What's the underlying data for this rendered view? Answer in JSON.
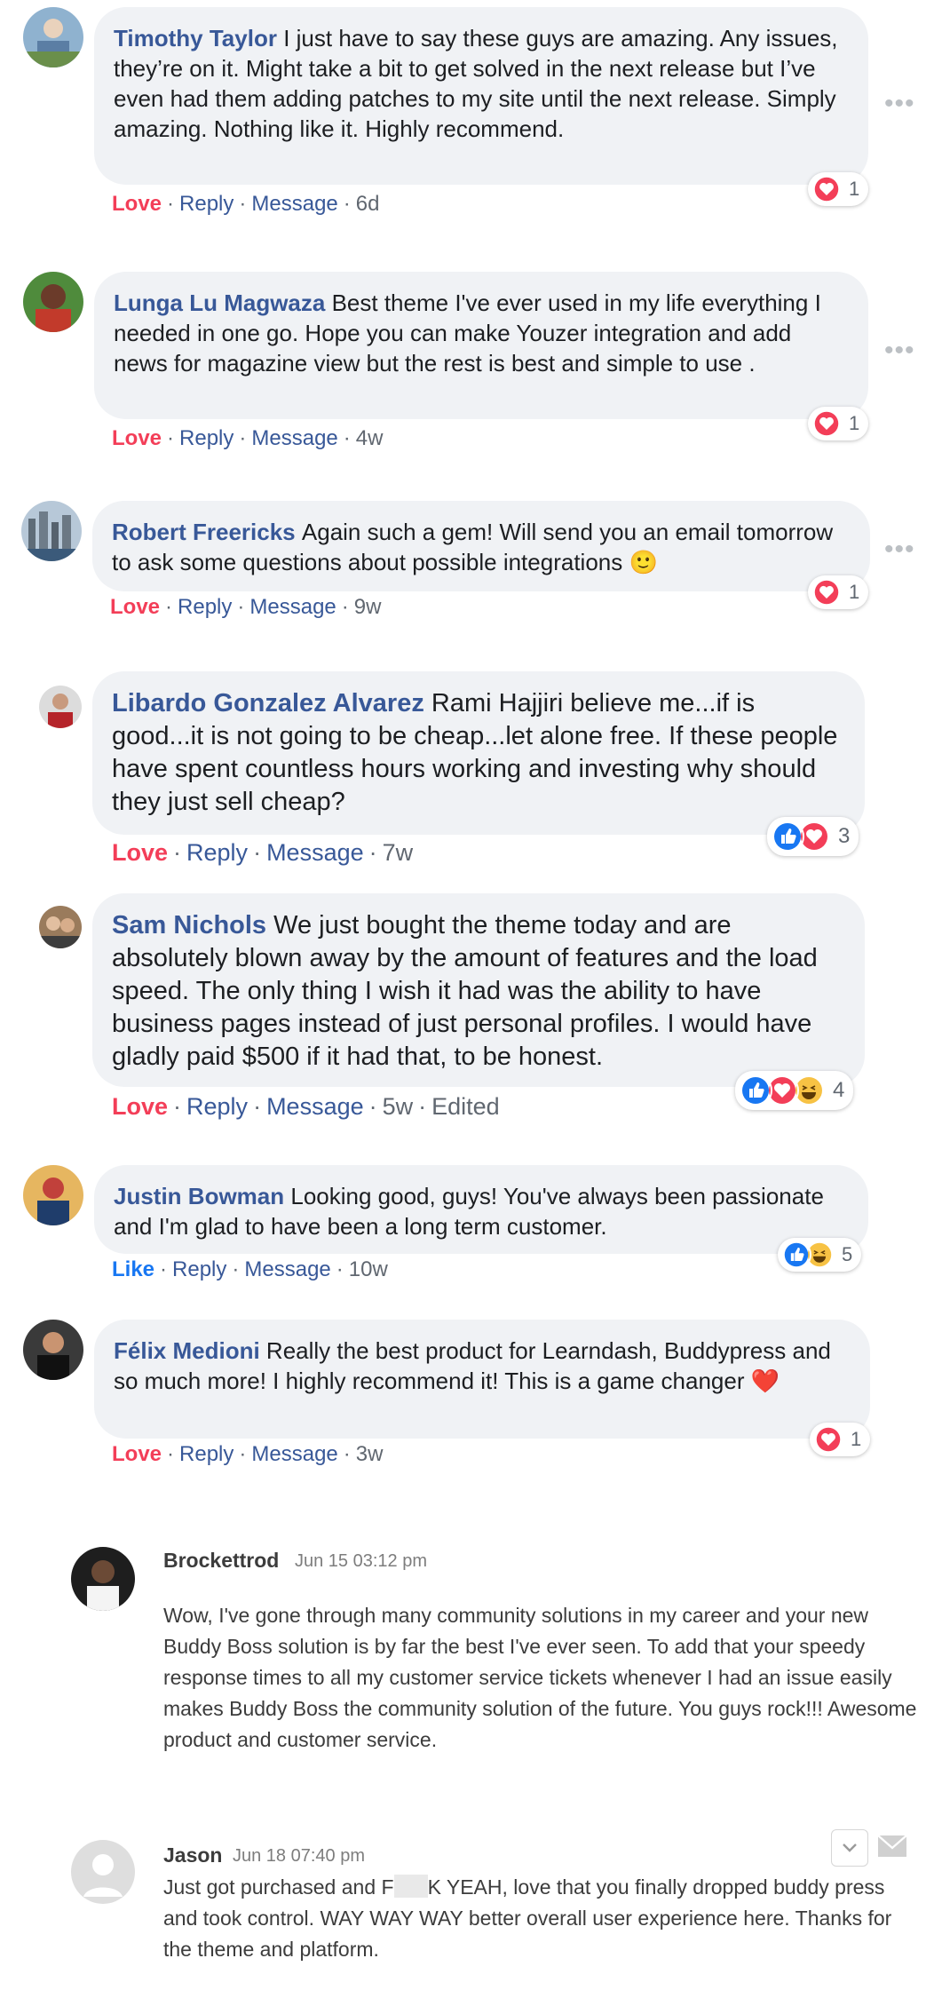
{
  "comments": [
    {
      "author": "Timothy Taylor",
      "text": "I just have to say these guys are amazing. Any issues, they’re on it. Might take a bit to get solved in the next release but I’ve even had them adding patches to my site until the next release. Simply amazing. Nothing like it. Highly recommend.",
      "reaction_label": "Love",
      "reply": "Reply",
      "message": "Message",
      "time": "6d",
      "reaction_count": "1"
    },
    {
      "author": "Lunga Lu Magwaza",
      "text": "Best theme I've ever used in my life everything I needed in one go. Hope you can make Youzer integration and add news for magazine view but the rest is best and simple to use .",
      "reaction_label": "Love",
      "reply": "Reply",
      "message": "Message",
      "time": "4w",
      "reaction_count": "1"
    },
    {
      "author": "Robert Freericks",
      "text": "Again such a gem! Will send you an email tomorrow to ask some questions about possible integrations",
      "emoji": "🙂",
      "reaction_label": "Love",
      "reply": "Reply",
      "message": "Message",
      "time": "9w",
      "reaction_count": "1"
    },
    {
      "author": "Libardo Gonzalez Alvarez",
      "text": "Rami Hajjiri believe me...if is good...it is not going to be cheap...let alone free. If these people have spent countless hours working and investing why should they just sell cheap?",
      "reaction_label": "Love",
      "reply": "Reply",
      "message": "Message",
      "time": "7w",
      "reaction_count": "3"
    },
    {
      "author": "Sam Nichols",
      "text": "We just bought the theme today and are absolutely blown away by the amount of features and the load speed. The only thing I wish it had was the ability to have business pages instead of just personal profiles. I would have gladly paid $500 if it had that, to be honest.",
      "reaction_label": "Love",
      "reply": "Reply",
      "message": "Message",
      "time": "5w",
      "edited": "Edited",
      "reaction_count": "4"
    },
    {
      "author": "Justin Bowman",
      "text": "Looking good, guys! You've always been passionate and I'm glad to have been a long term customer.",
      "reaction_label": "Like",
      "reply": "Reply",
      "message": "Message",
      "time": "10w",
      "reaction_count": "5"
    },
    {
      "author": "Félix Medioni",
      "text": "Really the best product for Learndash, Buddypress and so much more! I highly recommend it! This is a game changer",
      "emoji": "❤️",
      "reaction_label": "Love",
      "reply": "Reply",
      "message": "Message",
      "time": "3w",
      "reaction_count": "1"
    }
  ],
  "forum_posts": [
    {
      "author": "Brockettrod",
      "date": "Jun 15 03:12 pm",
      "text": "Wow, I've gone through many community solutions in my career and your new Buddy Boss solution is by far the best I've ever seen. To add that your speedy response times to all my customer service tickets whenever I had an issue easily makes Buddy Boss the community solution of the future. You guys rock!!! Awesome product and customer service."
    },
    {
      "author": "Jason",
      "date": "Jun 18 07:40 pm",
      "text_before": "Just got purchased and F",
      "text_after": "K YEAH, love that you finally dropped buddy press and took control. WAY WAY WAY better overall user experience here. Thanks for the theme and platform."
    }
  ],
  "icons": {
    "more": "more-options-icon",
    "love": "love-reaction-icon",
    "like": "like-reaction-icon",
    "haha": "haha-reaction-icon",
    "dropdown": "chevron-down-icon",
    "mail": "envelope-icon"
  },
  "colors": {
    "author": "#385898",
    "love": "#f33e58",
    "like": "#1877f2",
    "bubble": "#f0f2f5",
    "meta": "#606770"
  }
}
